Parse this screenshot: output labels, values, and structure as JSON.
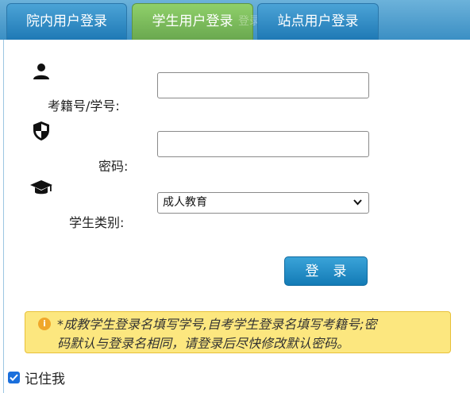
{
  "tabs": [
    {
      "label": "院内用户登录",
      "active": false
    },
    {
      "label": "学生用户登录",
      "active": true
    },
    {
      "label": "站点用户登录",
      "active": false
    }
  ],
  "ghost_text": "登录",
  "form": {
    "username_label": "考籍号/学号:",
    "username_value": "",
    "password_label": "密码:",
    "password_value": "",
    "category_label": "学生类别:",
    "category_selected": "成人教育"
  },
  "login_button": "登录",
  "notice": {
    "line1": "*成教学生登录名填写学号,自考学生登录名填写考籍号;密",
    "line2": "码默认与登录名相同，请登录后尽快修改默认密码。"
  },
  "remember": {
    "label": "记住我",
    "checked": true
  },
  "colors": {
    "tab_blue": "#1f79b5",
    "tab_active": "#6aa84f",
    "notice_bg": "#fce77f",
    "button": "#137bb6"
  },
  "icons": [
    "user-icon",
    "shield-icon",
    "graduation-cap-icon",
    "info-icon",
    "chevron-down-icon",
    "check-icon"
  ]
}
